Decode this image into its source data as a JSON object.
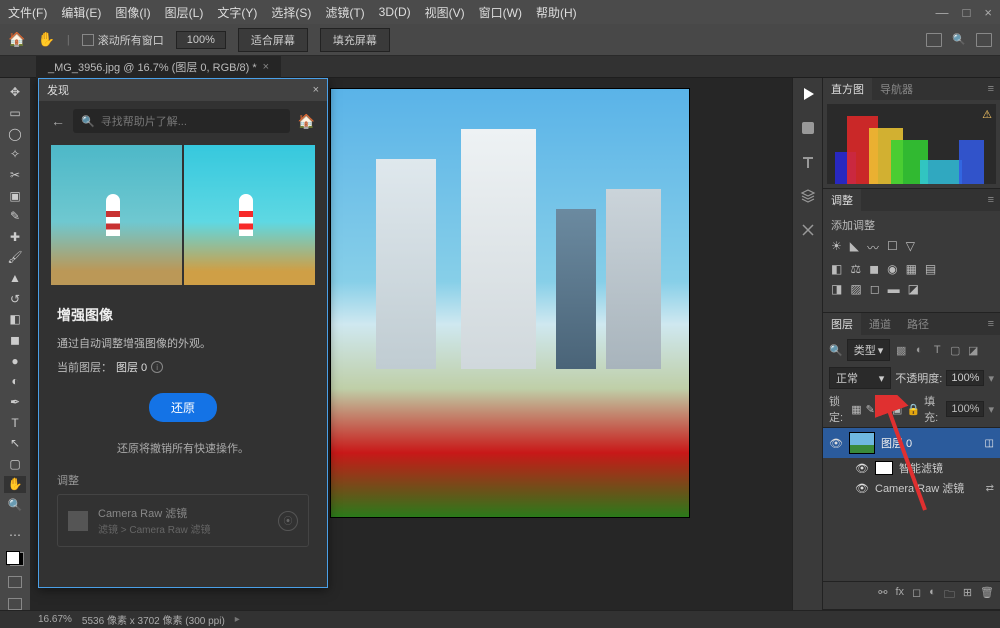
{
  "menubar": {
    "items": [
      "文件(F)",
      "编辑(E)",
      "图像(I)",
      "图层(L)",
      "文字(Y)",
      "选择(S)",
      "滤镜(T)",
      "3D(D)",
      "视图(V)",
      "窗口(W)",
      "帮助(H)"
    ]
  },
  "optionsbar": {
    "scroll_all": "滚动所有窗口",
    "zoom": "100%",
    "fit": "适合屏幕",
    "fill": "填充屏幕"
  },
  "doctab": {
    "title": "_MG_3956.jpg @ 16.7% (图层 0, RGB/8) *"
  },
  "discover": {
    "title": "发现",
    "search_placeholder": "寻找帮助片了解...",
    "heading": "增强图像",
    "desc": "通过自动调整增强图像的外观。",
    "current_layer_label": "当前图层：",
    "current_layer_value": "图层 0",
    "button": "还原",
    "note": "还原将撤销所有快速操作。",
    "section": "调整",
    "filter_title": "Camera Raw 滤镜",
    "filter_sub": "滤镜 > Camera Raw 滤镜"
  },
  "right": {
    "histogram_tab": "直方图",
    "navigator_tab": "导航器",
    "adjust_tab": "调整",
    "adjust_label": "添加调整",
    "layers_tab": "图层",
    "channels_tab": "通道",
    "paths_tab": "路径",
    "kind_label": "类型",
    "blend": "正常",
    "opacity_label": "不透明度:",
    "opacity_value": "100%",
    "lock_label": "锁定:",
    "fill_label": "填充:",
    "fill_value": "100%",
    "layer0": "图层 0",
    "smart_filters": "智能滤镜",
    "cr_filter": "Camera Raw 滤镜"
  },
  "status": {
    "zoom": "16.67%",
    "dims": "5536 像素 x 3702 像素 (300 ppi)"
  }
}
